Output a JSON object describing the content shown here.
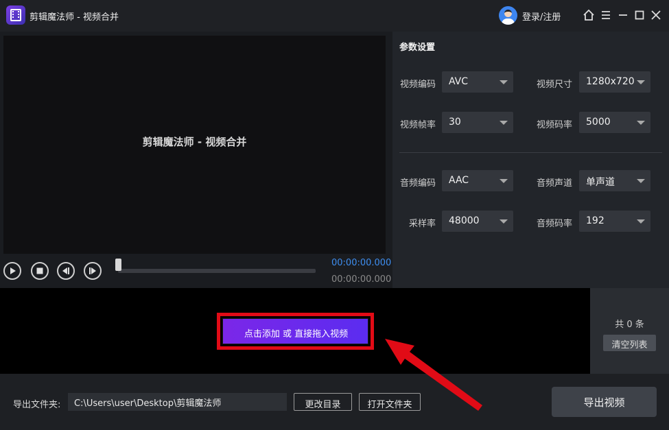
{
  "titlebar": {
    "app_name": "剪辑魔法师 - 视频合并",
    "login": "登录/注册"
  },
  "preview": {
    "text": "剪辑魔法师 - 视频合并",
    "current_time": "00:00:00.000",
    "total_time": "00:00:00.000",
    "progress": 0
  },
  "settings": {
    "title": "参数设置",
    "video_codec": {
      "label": "视频编码",
      "value": "AVC"
    },
    "video_size": {
      "label": "视频尺寸",
      "value": "1280x720"
    },
    "frame_rate": {
      "label": "视频帧率",
      "value": "30"
    },
    "video_bitrate": {
      "label": "视频码率",
      "value": "5000"
    },
    "audio_codec": {
      "label": "音频编码",
      "value": "AAC"
    },
    "audio_channel": {
      "label": "音频声道",
      "value": "单声道"
    },
    "sample_rate": {
      "label": "采样率",
      "value": "48000"
    },
    "audio_bitrate": {
      "label": "音频码率",
      "value": "192"
    }
  },
  "dropzone": {
    "add_button": "点击添加 或 直接拖入视频",
    "count_text": "共 0 条",
    "clear_button": "清空列表"
  },
  "bottom": {
    "output_label": "导出文件夹:",
    "output_path": "C:\\Users\\user\\Desktop\\剪辑魔法师",
    "change_dir_button": "更改目录",
    "open_folder_button": "打开文件夹",
    "export_button": "导出视频"
  },
  "colors": {
    "accent_purple": "#7b27e8",
    "time_blue": "#3e8ef0",
    "annotation_red": "#e10b16"
  },
  "icons": [
    "film-logo-icon",
    "user-avatar-icon",
    "home-icon",
    "menu-icon",
    "minimize-icon",
    "maximize-icon",
    "close-icon",
    "play-icon",
    "stop-icon",
    "prev-frame-icon",
    "next-frame-icon",
    "red-arrow-icon"
  ]
}
